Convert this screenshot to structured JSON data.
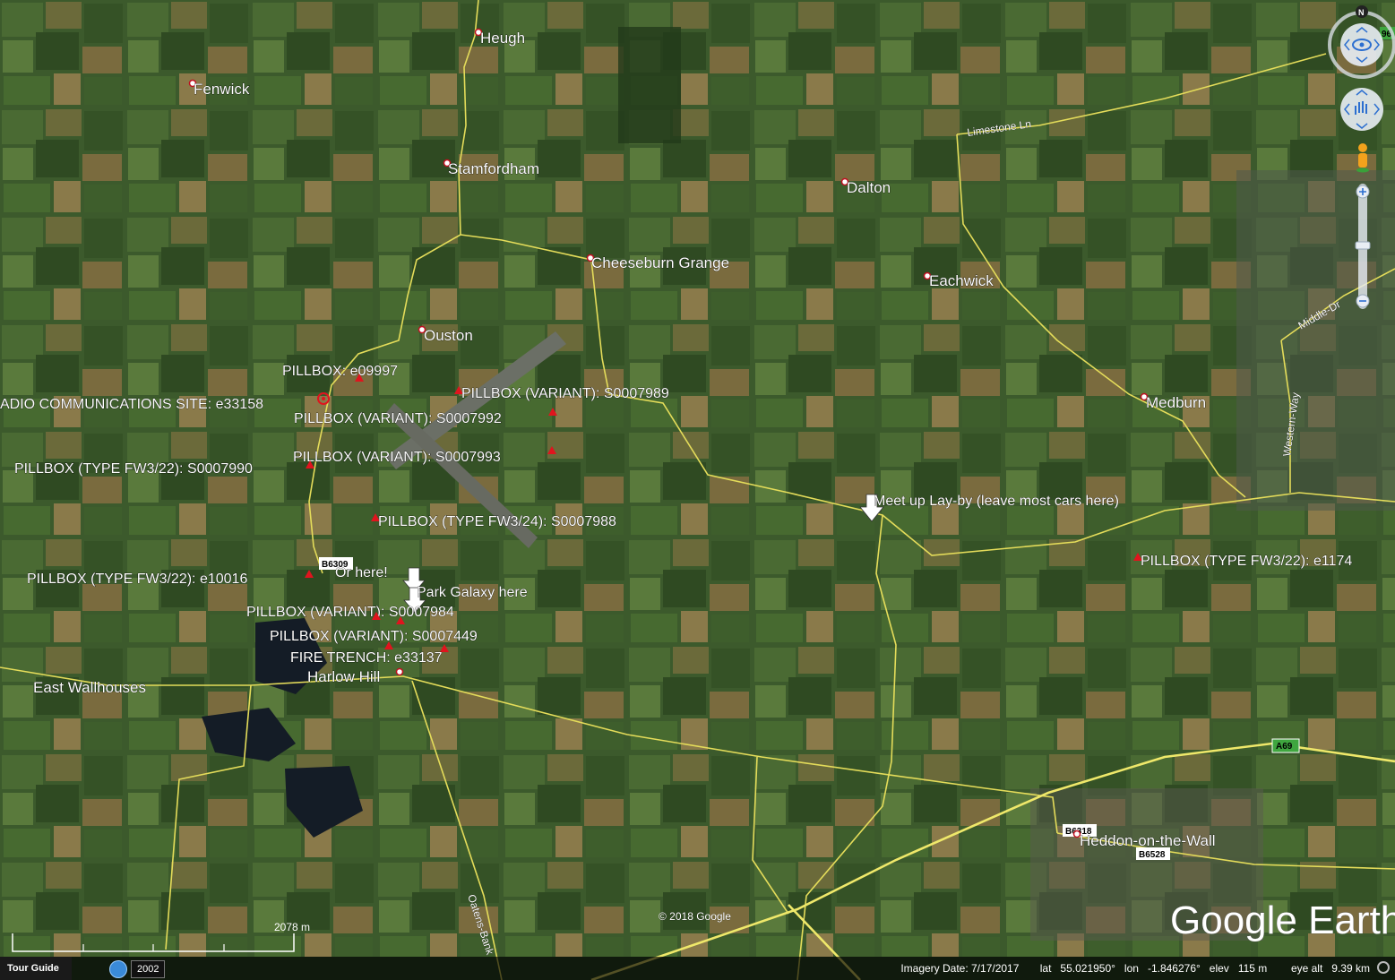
{
  "places": {
    "heugh": "Heugh",
    "fenwick": "Fenwick",
    "stamfordham": "Stamfordham",
    "dalton": "Dalton",
    "cheeseburn": "Cheeseburn Grange",
    "eachwick": "Eachwick",
    "ouston": "Ouston",
    "medburn": "Medburn",
    "east_wallhouses": "East Wallhouses",
    "harlow_hill": "Harlow Hill",
    "heddon": "Heddon-on-the-Wall"
  },
  "placemarks": {
    "pb_e09997": "PILLBOX:  e09997",
    "radio_site": "ADIO COMMUNICATIONS SITE:  e33158",
    "pb_s0007989": "PILLBOX (VARIANT): S0007989",
    "pb_s0007992": "PILLBOX (VARIANT): S0007992",
    "pb_s0007993": "PILLBOX (VARIANT): S0007993",
    "pb_s0007990": "PILLBOX (TYPE FW3/22): S0007990",
    "pb_s0007988": "PILLBOX (TYPE FW3/24): S0007988",
    "pb_e10016": "PILLBOX (TYPE FW3/22):  e10016",
    "or_here": "Or here!",
    "park_galaxy": "Park Galaxy here",
    "pb_s0007984": "PILLBOX (VARIANT): S0007984",
    "pb_s0007449": "PILLBOX (VARIANT): S0007449",
    "fire_trench": "FIRE TRENCH:  e33137",
    "meet_up": "Meet up Lay-by (leave most cars here)",
    "pb_e1174": "PILLBOX (TYPE FW3/22):  e1174"
  },
  "roads": {
    "limestone_ln": "Limestone Ln",
    "middle_dr": "Middle-Dr",
    "western_way": "Western-Way",
    "oatens_bank": "Oatens-Bank",
    "shield_a69": "A69",
    "shield_b6318": "B6318",
    "shield_b6528": "B6528",
    "shield_b6309": "B6309",
    "shield_top": "96"
  },
  "overlay": {
    "copyright": "© 2018 Google",
    "scale_label": "2078 m",
    "logo": "Google Earth",
    "compass_n": "N"
  },
  "status_bar": {
    "tour_guide": "Tour Guide",
    "history_year": "2002",
    "imagery_info": "Imagery Date: 7/17/2017       lat   55.021950°   lon   -1.846276°   elev   115 m        eye alt   9.39 km"
  },
  "colors": {
    "road": "#e4dc5a",
    "marker": "#e0141e",
    "label": "#ffffff",
    "shield": "#3fa63f"
  }
}
